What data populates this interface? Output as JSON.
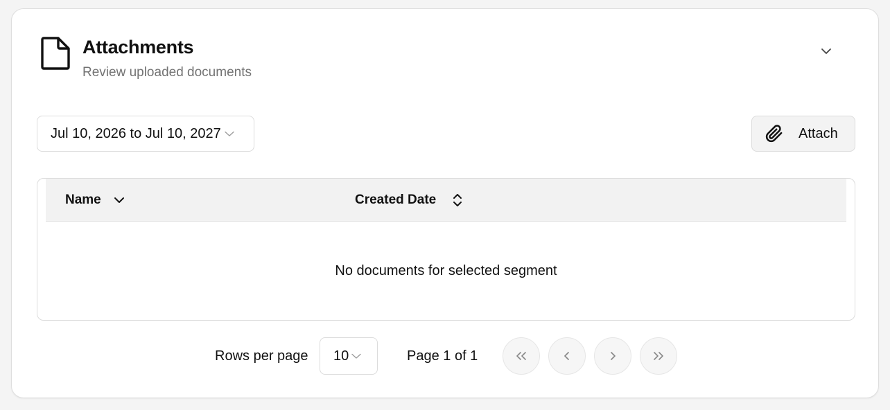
{
  "card": {
    "title": "Attachments",
    "subtitle": "Review uploaded documents",
    "icon": "document-icon",
    "collapse_icon": "chevron-down-icon"
  },
  "toolbar": {
    "date_range": "Jul 10, 2026 to Jul 10, 2027",
    "attach_label": "Attach",
    "attach_icon": "paperclip-icon"
  },
  "table": {
    "columns": [
      {
        "label": "Name",
        "sort_icon": "chevron-down-icon"
      },
      {
        "label": "Created Date",
        "sort_icon": "sort-updown-icon"
      }
    ],
    "empty_message": "No documents for selected segment"
  },
  "pagination": {
    "rows_per_page_label": "Rows per page",
    "rows_per_page_value": "10",
    "page_label": "Page 1 of 1"
  },
  "colors": {
    "background": "#f4f4f4",
    "card": "#ffffff",
    "header_row": "#f2f2f2",
    "border": "#dcdcdc",
    "subtitle_text": "#737373"
  }
}
